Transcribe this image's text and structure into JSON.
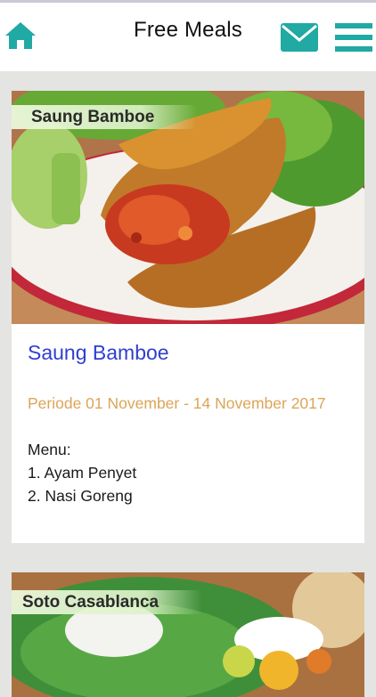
{
  "header": {
    "title": "Free Meals",
    "icons": {
      "home": "home-icon",
      "mail": "mail-icon",
      "menu": "hamburger-menu-icon"
    },
    "accent_color": "#21a9a3"
  },
  "cards": [
    {
      "ribbon": "Saung Bamboe",
      "title": "Saung Bamboe",
      "period": "Periode 01 November - 14 November 2017",
      "menu_heading": "Menu:",
      "menu_items": [
        "1. Ayam Penyet",
        "2. Nasi Goreng"
      ]
    },
    {
      "ribbon": "Soto Casablanca"
    }
  ],
  "colors": {
    "title_link": "#2f3fd0",
    "period_text": "#dba558",
    "background": "#e4e4e2"
  }
}
